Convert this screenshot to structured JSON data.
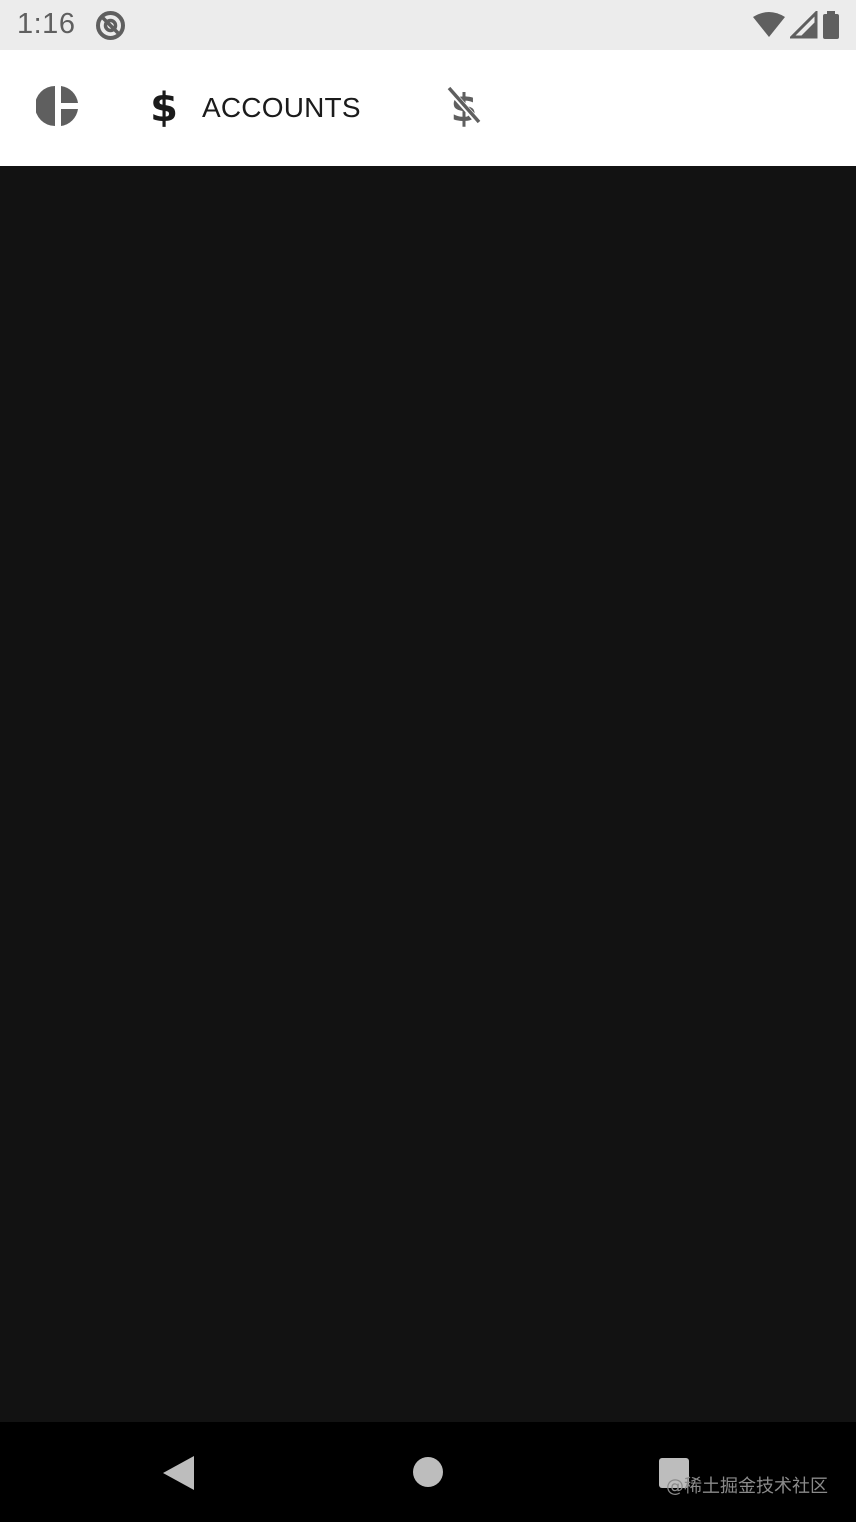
{
  "status_bar": {
    "time": "1:16",
    "icons": [
      "app-notification-icon",
      "wifi-icon",
      "cell-signal-icon",
      "battery-icon"
    ]
  },
  "tabs": [
    {
      "icon": "pie-chart-icon",
      "label": "",
      "selected": false
    },
    {
      "icon": "dollar-icon",
      "label": "ACCOUNTS",
      "selected": true
    },
    {
      "icon": "money-off-icon",
      "label": "",
      "selected": false
    }
  ],
  "nav_bar": {
    "buttons": [
      "back",
      "home",
      "recents"
    ]
  },
  "watermark": "@稀土掘金技术社区",
  "colors": {
    "status_bar_bg": "#ececec",
    "tab_bar_bg": "#ffffff",
    "content_bg": "#121212",
    "nav_bar_bg": "#000000",
    "inactive_icon": "#5f5f5f",
    "active_icon": "#1b1b1b"
  }
}
